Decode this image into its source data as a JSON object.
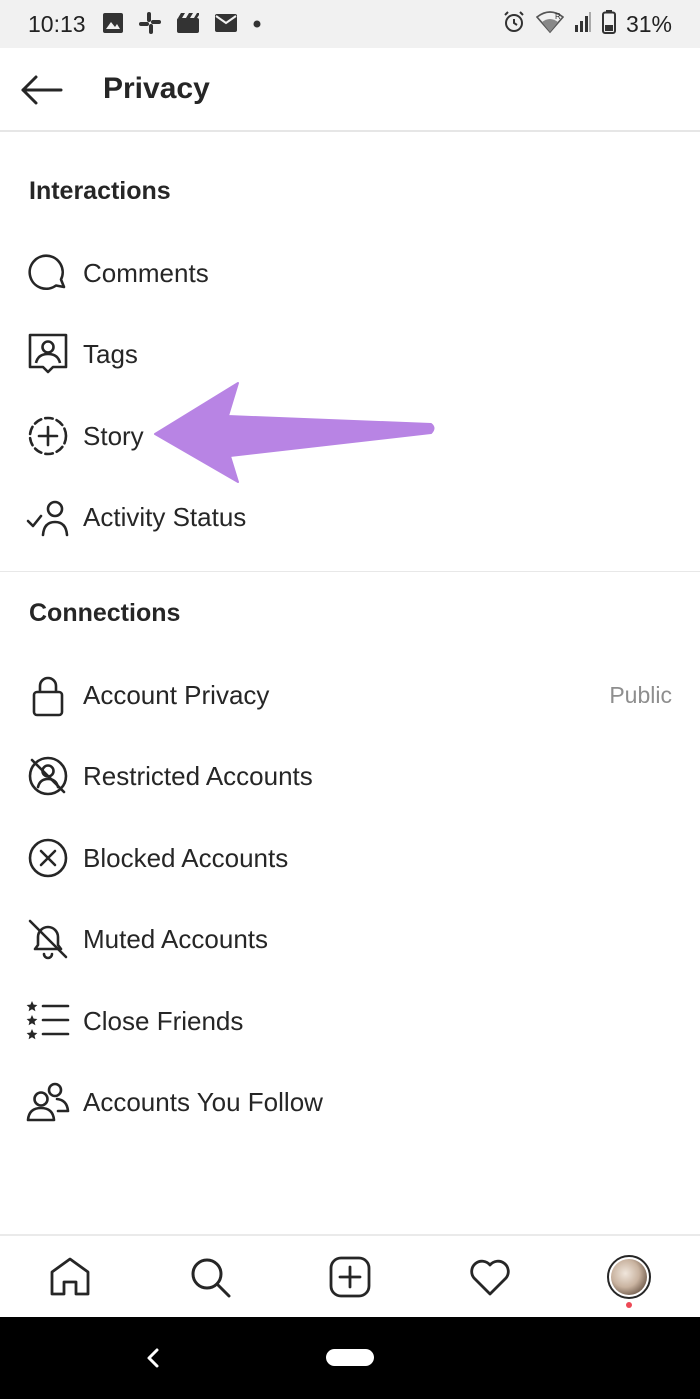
{
  "status_bar": {
    "time": "10:13",
    "battery": "31%",
    "left_icons": [
      "image-icon",
      "slack-icon",
      "clapper-icon",
      "mail-icon",
      "dot-icon"
    ],
    "right_icons": [
      "alarm-icon",
      "wifi-icon",
      "signal-icon",
      "battery-icon"
    ],
    "signal_roaming_label": "R"
  },
  "header": {
    "title": "Privacy",
    "back_icon": "arrow-left-icon"
  },
  "sections": {
    "interactions": {
      "title": "Interactions",
      "items": [
        {
          "label": "Comments",
          "icon": "comment-bubble-icon"
        },
        {
          "label": "Tags",
          "icon": "tag-person-icon"
        },
        {
          "label": "Story",
          "icon": "story-add-icon"
        },
        {
          "label": "Activity Status",
          "icon": "activity-status-icon"
        }
      ]
    },
    "connections": {
      "title": "Connections",
      "items": [
        {
          "label": "Account Privacy",
          "icon": "lock-icon",
          "value": "Public"
        },
        {
          "label": "Restricted Accounts",
          "icon": "restricted-icon"
        },
        {
          "label": "Blocked Accounts",
          "icon": "blocked-icon"
        },
        {
          "label": "Muted Accounts",
          "icon": "muted-bell-icon"
        },
        {
          "label": "Close Friends",
          "icon": "close-friends-list-icon"
        },
        {
          "label": "Accounts You Follow",
          "icon": "following-people-icon"
        }
      ]
    }
  },
  "annotation": {
    "icon": "pointer-arrow-icon",
    "color": "#b884e4"
  },
  "tab_bar": {
    "tabs": [
      "home-icon",
      "search-icon",
      "new-post-icon",
      "activity-heart-icon",
      "profile-avatar"
    ],
    "notification_color": "#ed4956"
  },
  "system_nav": {
    "back_icon": "nav-back-icon",
    "home_icon": "nav-home-pill"
  }
}
